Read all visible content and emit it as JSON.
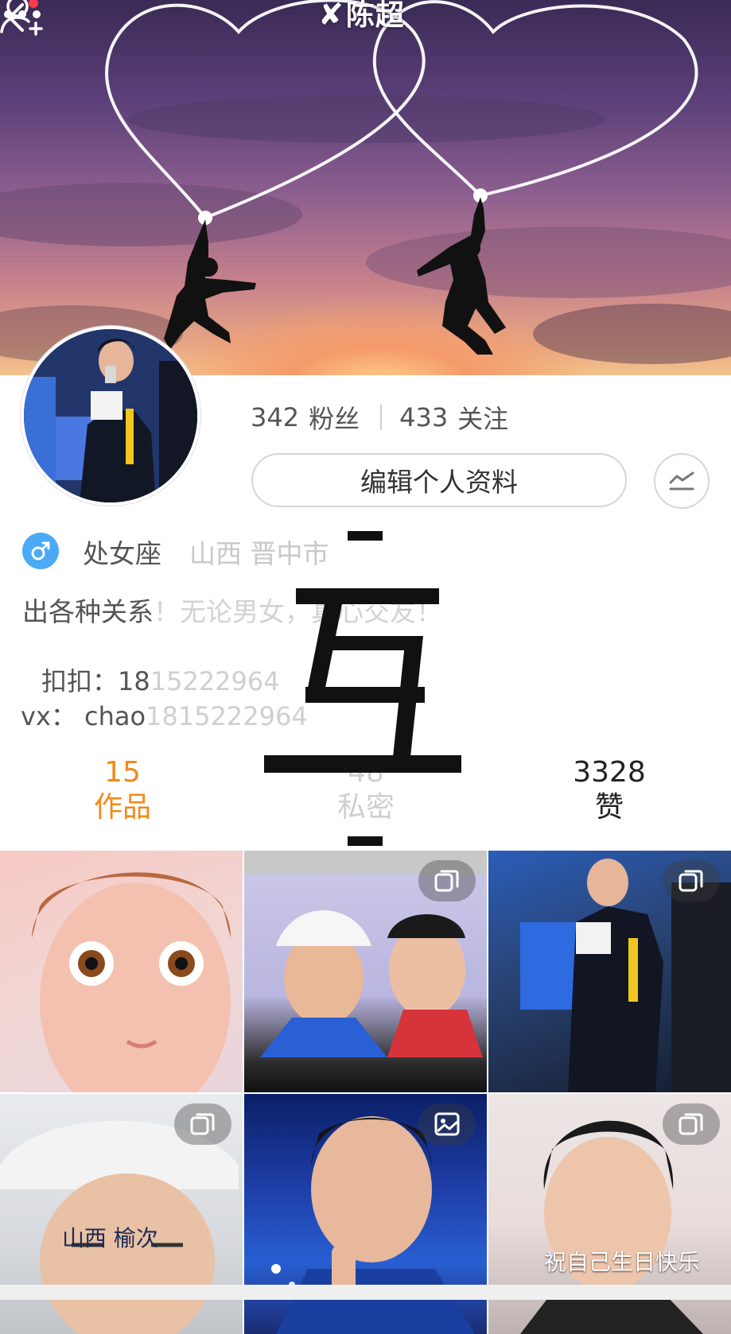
{
  "header": {
    "title_mark": "✘",
    "title": "陈超",
    "back_icon": "chevron-left-icon",
    "add_friend_icon": "add-friend-icon",
    "more_icon": "more-icon"
  },
  "profile": {
    "followers_count": "342",
    "followers_label": "粉丝",
    "following_count": "433",
    "following_label": "关注",
    "edit_button": "编辑个人资料",
    "gender": "male",
    "zodiac": "处女座",
    "location": "山西 晋中市",
    "bio_line1_visible": "出各种关系",
    "bio_line1_faded": "！无论男女，真心交友！",
    "bio_line2_prefix": "扣扣：18",
    "bio_line2_faded": "15222964",
    "bio_line3_prefix": "vx： chao",
    "bio_line3_faded": "1815222964"
  },
  "overlay": {
    "glyph": "互"
  },
  "tabs": [
    {
      "count": "15",
      "label": "作品",
      "active": true
    },
    {
      "count": "48",
      "label": "私密",
      "active": false
    },
    {
      "count": "3328",
      "label": "赞",
      "active": false
    }
  ],
  "grid": {
    "captions": {
      "tile4": "山西  榆次",
      "tile6": "祝自己生日快乐"
    }
  },
  "colors": {
    "accent": "#f28a1a",
    "gender_badge": "#4aaaf5"
  }
}
